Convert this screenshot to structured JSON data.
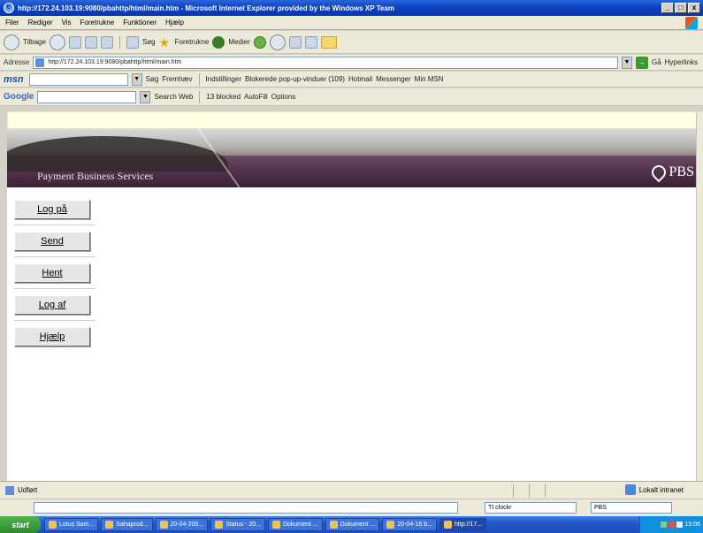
{
  "window": {
    "title": "http://172.24.103.19:9080/pbahttp/html/main.htm - Microsoft Internet Explorer provided by the Windows XP Team",
    "buttons": [
      "_",
      "□",
      "x"
    ]
  },
  "menu": [
    "Filer",
    "Rediger",
    "Vis",
    "Foretrukne",
    "Funktioner",
    "Hjælp"
  ],
  "toolbar": {
    "back": "Tilbage",
    "search": "Søg",
    "favorites": "Foretrukne",
    "media": "Medier"
  },
  "address": {
    "label": "Adresse",
    "url": "http://172.24.103.19:9080/pbahttp/html/main.htm",
    "go": "Gå",
    "links": "Hyperlinks"
  },
  "msnbar": {
    "logo": "msn",
    "search": "Søg",
    "highlight": "Fremhæv",
    "settings": "Indstillinger",
    "popups": "Blokerede pop-up-vinduer (109)",
    "hotmail": "Hotmail",
    "messenger": "Messenger",
    "my_msn": "Min MSN"
  },
  "googlebar": {
    "logo": "Google",
    "search_web": "Search Web",
    "blocked": "13 blocked",
    "autofill": "AutoFill",
    "options": "Options"
  },
  "banner": {
    "title": "Payment Business Services",
    "logo": "PBS"
  },
  "nav": [
    {
      "label": "Log på"
    },
    {
      "label": "Send"
    },
    {
      "label": "Hent"
    },
    {
      "label": "Log af"
    },
    {
      "label": "Hjælp"
    }
  ],
  "status": {
    "text": "Udført",
    "zone": "Lokalt intranet"
  },
  "langbar": {
    "box1": "TI clockr",
    "box2": "PBS"
  },
  "taskbar": {
    "start": "start",
    "tasks": [
      "Lotus Sam...",
      "Sahaprod...",
      "20-04-200...",
      "Status - 20...",
      "Dokument ...",
      "Dokument ...",
      "20-04-16 b...",
      "http://17..."
    ],
    "clock": "15:06"
  }
}
